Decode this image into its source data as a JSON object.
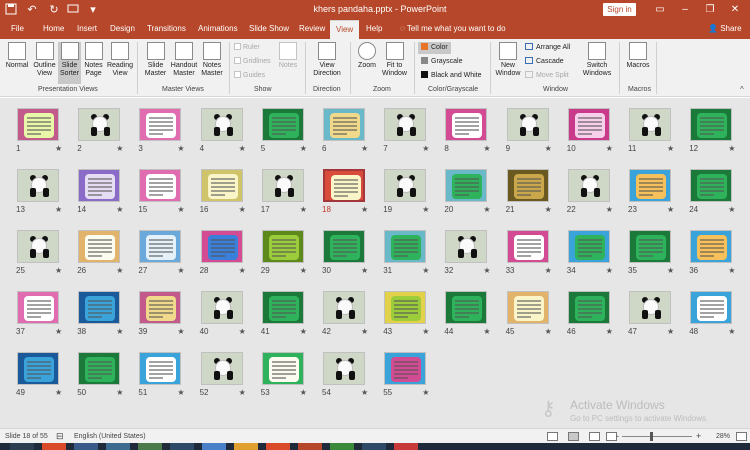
{
  "window": {
    "title": "khers pandaha.pptx  -  PowerPoint",
    "signin": "Sign in"
  },
  "titlebar_icons": [
    "save-icon",
    "undo-icon",
    "redo-icon",
    "present-from-beginning-icon",
    "customize-quick-access-icon"
  ],
  "tabs": [
    "File",
    "Home",
    "Insert",
    "Design",
    "Transitions",
    "Animations",
    "Slide Show",
    "Review",
    "View",
    "Help"
  ],
  "active_tab": "View",
  "tell_me": "Tell me what you want to do",
  "share": "Share",
  "ribbon": {
    "presentation_views": {
      "label": "Presentation Views",
      "buttons": [
        "Normal",
        "Outline View",
        "Slide Sorter",
        "Notes Page",
        "Reading View"
      ],
      "selected": "Slide Sorter"
    },
    "master_views": {
      "label": "Master Views",
      "buttons": [
        "Slide Master",
        "Handout Master",
        "Notes Master"
      ]
    },
    "show": {
      "label": "Show",
      "checkboxes": [
        "Ruler",
        "Gridlines",
        "Guides"
      ],
      "notes": "Notes"
    },
    "direction": {
      "label": "Direction",
      "button": "View Direction"
    },
    "zoom": {
      "label": "Zoom",
      "buttons": [
        "Zoom",
        "Fit to Window"
      ]
    },
    "color_grayscale": {
      "label": "Color/Grayscale",
      "options": [
        "Color",
        "Grayscale",
        "Black and White"
      ],
      "selected": "Color"
    },
    "window": {
      "label": "Window",
      "new_window": "New Window",
      "items": [
        "Arrange All",
        "Cascade",
        "Move Split"
      ],
      "switch": "Switch Windows"
    },
    "macros": {
      "label": "Macros",
      "button": "Macros"
    }
  },
  "slides": [
    {
      "n": "1",
      "kind": "text",
      "fill": "#e8f7a8",
      "border": "#c35a8c"
    },
    {
      "n": "2",
      "kind": "photo"
    },
    {
      "n": "3",
      "kind": "text",
      "fill": "#ffffff",
      "border": "#e06db0"
    },
    {
      "n": "4",
      "kind": "photo"
    },
    {
      "n": "5",
      "kind": "text",
      "fill": "#2eb35c",
      "border": "#1b7a3a"
    },
    {
      "n": "6",
      "kind": "text",
      "fill": "#f0d98a",
      "border": "#6ab9c8"
    },
    {
      "n": "7",
      "kind": "photo"
    },
    {
      "n": "8",
      "kind": "text",
      "fill": "#ffffff",
      "border": "#d24b93"
    },
    {
      "n": "9",
      "kind": "photo"
    },
    {
      "n": "10",
      "kind": "text",
      "fill": "#f6d0ea",
      "border": "#c93a8a"
    },
    {
      "n": "11",
      "kind": "photo"
    },
    {
      "n": "12",
      "kind": "text",
      "fill": "#2eb35c",
      "border": "#1b7a3a"
    },
    {
      "n": "13",
      "kind": "photo"
    },
    {
      "n": "14",
      "kind": "text",
      "fill": "#e4ddf4",
      "border": "#8a6cc8"
    },
    {
      "n": "15",
      "kind": "text",
      "fill": "#ffffff",
      "border": "#e06db0"
    },
    {
      "n": "16",
      "kind": "text",
      "fill": "#f9f5c8",
      "border": "#cfc46a"
    },
    {
      "n": "17",
      "kind": "photo"
    },
    {
      "n": "18",
      "kind": "text",
      "fill": "#f9f5c8",
      "border": "#d94b3a"
    },
    {
      "n": "19",
      "kind": "photo"
    },
    {
      "n": "20",
      "kind": "text",
      "fill": "#2eb35c",
      "border": "#6ab9c8"
    },
    {
      "n": "21",
      "kind": "text",
      "fill": "#c9a74a",
      "border": "#6a5a22"
    },
    {
      "n": "22",
      "kind": "photo"
    },
    {
      "n": "23",
      "kind": "text",
      "fill": "#f6c05a",
      "border": "#3aa3d9"
    },
    {
      "n": "24",
      "kind": "text",
      "fill": "#2eb35c",
      "border": "#1b7a3a"
    },
    {
      "n": "25",
      "kind": "photo"
    },
    {
      "n": "26",
      "kind": "text",
      "fill": "#fbfbf0",
      "border": "#e2b36a"
    },
    {
      "n": "27",
      "kind": "text",
      "fill": "#e4f1f9",
      "border": "#6aa9d9"
    },
    {
      "n": "28",
      "kind": "text",
      "fill": "#3a7fd9",
      "border": "#d24b93"
    },
    {
      "n": "29",
      "kind": "text",
      "fill": "#9ccc3a",
      "border": "#5e8a1c"
    },
    {
      "n": "30",
      "kind": "text",
      "fill": "#2eb35c",
      "border": "#1b7a3a"
    },
    {
      "n": "31",
      "kind": "text",
      "fill": "#2eb35c",
      "border": "#6ab9c8"
    },
    {
      "n": "32",
      "kind": "photo"
    },
    {
      "n": "33",
      "kind": "text",
      "fill": "#ffffff",
      "border": "#d24b93"
    },
    {
      "n": "34",
      "kind": "text",
      "fill": "#2eb35c",
      "border": "#3aa3d9"
    },
    {
      "n": "35",
      "kind": "text",
      "fill": "#2eb35c",
      "border": "#1b7a3a"
    },
    {
      "n": "36",
      "kind": "text",
      "fill": "#f6c05a",
      "border": "#3aa3d9"
    },
    {
      "n": "37",
      "kind": "text",
      "fill": "#ffffff",
      "border": "#e06db0"
    },
    {
      "n": "38",
      "kind": "text",
      "fill": "#3aa3d9",
      "border": "#1b5a9a"
    },
    {
      "n": "39",
      "kind": "text",
      "fill": "#f0d98a",
      "border": "#c35a8c"
    },
    {
      "n": "40",
      "kind": "photo"
    },
    {
      "n": "41",
      "kind": "text",
      "fill": "#2eb35c",
      "border": "#1b7a3a"
    },
    {
      "n": "42",
      "kind": "photo"
    },
    {
      "n": "43",
      "kind": "text",
      "fill": "#9ccc3a",
      "border": "#e2d24a"
    },
    {
      "n": "44",
      "kind": "text",
      "fill": "#2eb35c",
      "border": "#1b7a3a"
    },
    {
      "n": "45",
      "kind": "text",
      "fill": "#f9f5c8",
      "border": "#e2b36a"
    },
    {
      "n": "46",
      "kind": "text",
      "fill": "#2eb35c",
      "border": "#1b7a3a"
    },
    {
      "n": "47",
      "kind": "photo"
    },
    {
      "n": "48",
      "kind": "text",
      "fill": "#ffffff",
      "border": "#3aa3d9"
    },
    {
      "n": "49",
      "kind": "text",
      "fill": "#3aa3d9",
      "border": "#1b5a9a"
    },
    {
      "n": "50",
      "kind": "text",
      "fill": "#2eb35c",
      "border": "#1b7a3a"
    },
    {
      "n": "51",
      "kind": "text",
      "fill": "#ffffff",
      "border": "#3aa3d9"
    },
    {
      "n": "52",
      "kind": "photo"
    },
    {
      "n": "53",
      "kind": "text",
      "fill": "#fbfbf0",
      "border": "#2eb35c"
    },
    {
      "n": "54",
      "kind": "photo"
    },
    {
      "n": "55",
      "kind": "text",
      "fill": "#d24b93",
      "border": "#3aa3d9"
    }
  ],
  "selected_slide": "18",
  "transition_mark": "★",
  "watermark": {
    "title": "Activate Windows",
    "subtitle": "Go to PC settings to activate Windows."
  },
  "status": {
    "slide_info": "Slide 18 of 55",
    "language": "English (United States)",
    "zoom_minus": "-",
    "zoom_plus": "+",
    "zoom_percent": "28%"
  },
  "colors": {
    "accent": "#b7472a",
    "selected_border": "#a4373a"
  }
}
